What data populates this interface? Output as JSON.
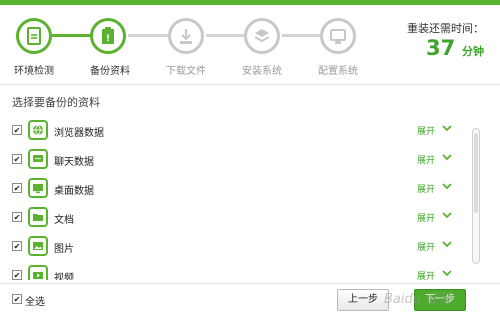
{
  "steps": [
    {
      "label": "环境检测",
      "state": "done"
    },
    {
      "label": "备份资料",
      "state": "active"
    },
    {
      "label": "下载文件",
      "state": "pending"
    },
    {
      "label": "安装系统",
      "state": "pending"
    },
    {
      "label": "配置系统",
      "state": "pending"
    }
  ],
  "timer": {
    "label": "重装还需时间：",
    "value": "37",
    "unit": "分钟"
  },
  "section_title": "选择要备份的资料",
  "items": [
    {
      "name": "浏览器数据",
      "expand": "展开",
      "checked": "✔",
      "icon": "globe-icon"
    },
    {
      "name": "聊天数据",
      "expand": "展开",
      "checked": "✔",
      "icon": "chat-icon"
    },
    {
      "name": "桌面数据",
      "expand": "展开",
      "checked": "✔",
      "icon": "monitor-icon"
    },
    {
      "name": "文档",
      "expand": "展开",
      "checked": "✔",
      "icon": "folder-icon"
    },
    {
      "name": "图片",
      "expand": "展开",
      "checked": "✔",
      "icon": "image-icon"
    },
    {
      "name": "视频",
      "expand": "展开",
      "checked": "✔",
      "icon": "video-icon"
    }
  ],
  "footer": {
    "select_all": "全选",
    "select_all_checked": "✔",
    "prev": "上一步",
    "next": "下一步"
  },
  "watermark": "Baidu 经验",
  "colors": {
    "accent": "#5ab22f",
    "inactive": "#c8c8c8"
  }
}
